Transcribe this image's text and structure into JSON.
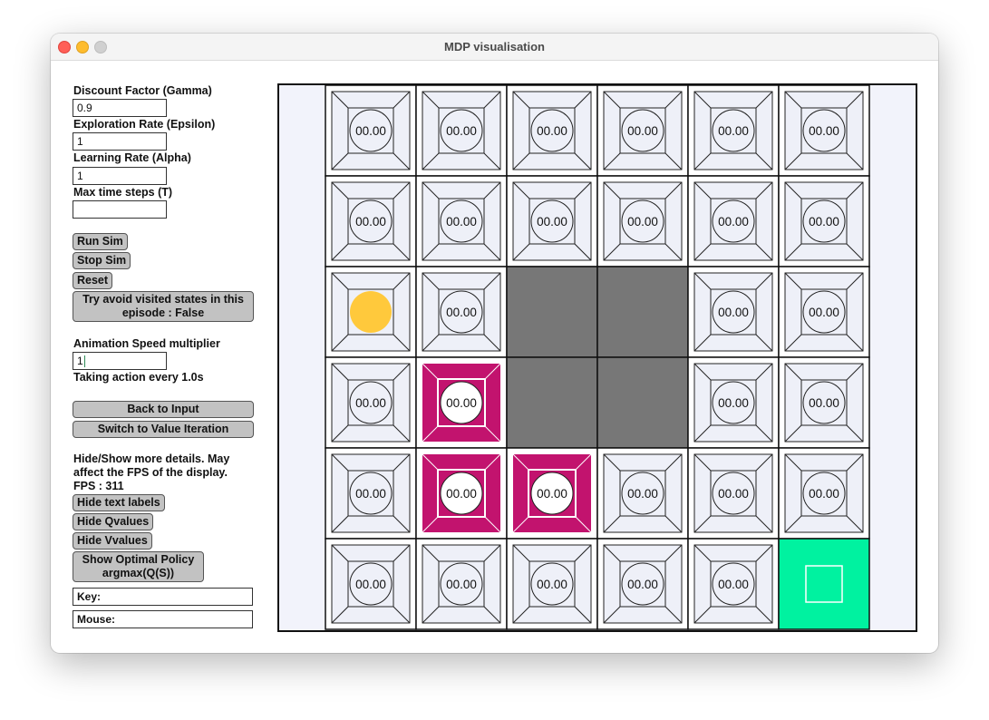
{
  "window": {
    "title": "MDP visualisation"
  },
  "params": {
    "gamma_label": "Discount Factor (Gamma)",
    "gamma_value": "0.9",
    "epsilon_label": "Exploration Rate (Epsilon)",
    "epsilon_value": "1",
    "alpha_label": "Learning Rate (Alpha)",
    "alpha_value": "1",
    "max_steps_label": "Max time steps (T)",
    "max_steps_value": ""
  },
  "buttons": {
    "run": "Run Sim",
    "stop": "Stop Sim",
    "reset": "Reset",
    "avoid_line1": "Try avoid visited states in this",
    "avoid_line2": "episode : False"
  },
  "animation": {
    "label": "Animation Speed multiplier",
    "value": "1",
    "status": "Taking action every 1.0s"
  },
  "nav": {
    "back": "Back to Input",
    "switch": "Switch to Value Iteration"
  },
  "details": {
    "line1": "Hide/Show more details. May",
    "line2": "affect the FPS of the display.",
    "fps": "FPS : 311",
    "hide_text": "Hide text labels",
    "hide_q": "Hide Qvalues",
    "hide_v": "Hide Vvalues",
    "policy_line1": "Show Optimal Policy",
    "policy_line2": "argmax(Q(S))"
  },
  "status": {
    "key": "Key:",
    "mouse": "Mouse:"
  },
  "grid": {
    "columns": 6,
    "rows": 6,
    "cell_value": "00.00",
    "colors": {
      "wall": "#777777",
      "goal": "#00f2a0",
      "visited": "#c2136e",
      "agent": "#ffc93c",
      "cell_bg": "#eef0f8"
    },
    "cells": [
      [
        "normal",
        "normal",
        "normal",
        "normal",
        "normal",
        "normal"
      ],
      [
        "normal",
        "normal",
        "normal",
        "normal",
        "normal",
        "normal"
      ],
      [
        "agent",
        "normal",
        "wall",
        "wall",
        "normal",
        "normal"
      ],
      [
        "normal",
        "visited",
        "wall",
        "wall",
        "normal",
        "normal"
      ],
      [
        "normal",
        "visited",
        "visited",
        "normal",
        "normal",
        "normal"
      ],
      [
        "normal",
        "normal",
        "normal",
        "normal",
        "normal",
        "goal"
      ]
    ]
  }
}
